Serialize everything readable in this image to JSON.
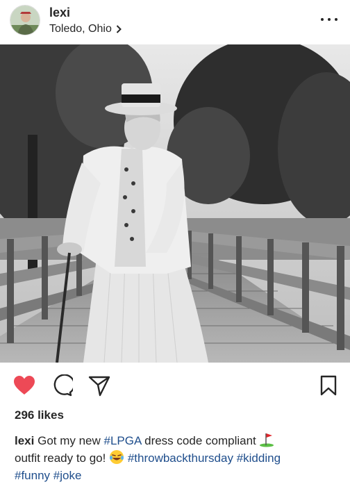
{
  "post": {
    "username": "lexi",
    "location": "Toledo, Ohio",
    "likes": "296 likes",
    "caption": {
      "user": "lexi",
      "seg1": "Got my new ",
      "tag_lpga": "#LPGA",
      "seg2": " dress code compliant ",
      "seg3": "outfit ready to go! ",
      "tag_throwback": "#throwbackthursday",
      "tag_kidding": "#kidding",
      "tag_funny": "#funny",
      "tag_joke": "#joke"
    }
  },
  "icons": {
    "more": "more-options-icon",
    "like": "heart-icon",
    "comment": "comment-icon",
    "share": "paper-plane-icon",
    "save": "bookmark-icon",
    "location_chevron": "chevron-right-icon",
    "emoji_golf": "golf-flag-emoji",
    "emoji_laugh": "laughing-tears-emoji"
  },
  "colors": {
    "like_red": "#ed4956",
    "hashtag_blue": "#1f4e8c",
    "text": "#262626"
  }
}
